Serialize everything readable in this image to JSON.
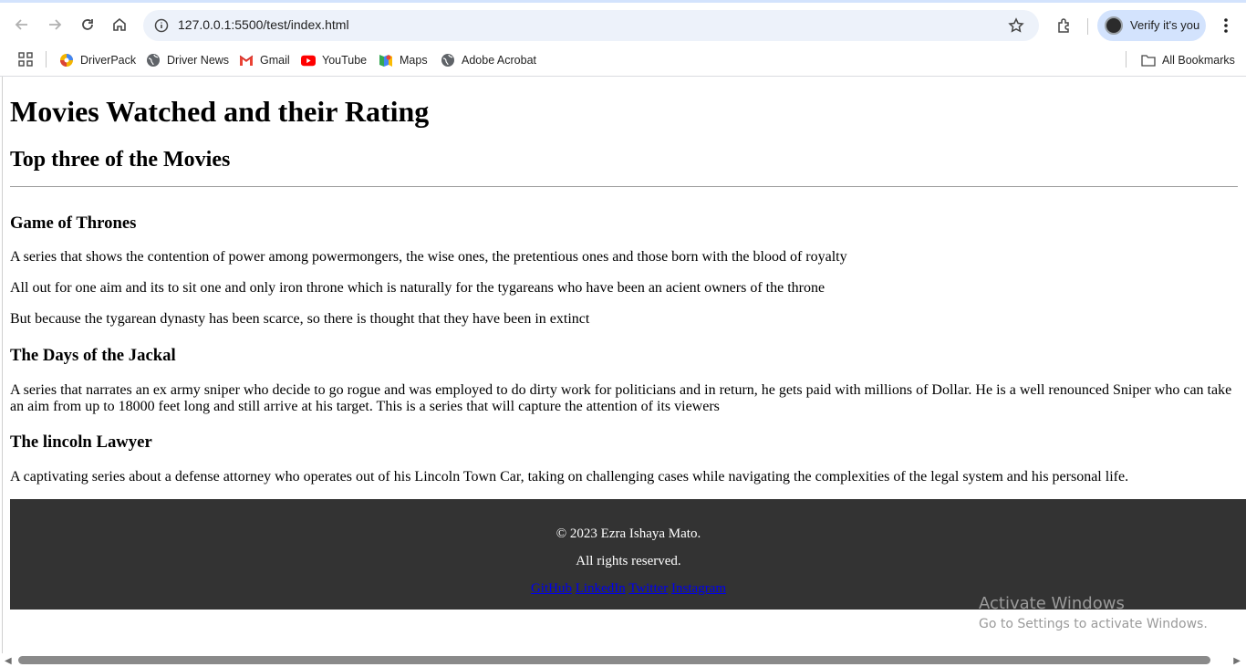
{
  "browser": {
    "url": "127.0.0.1:5500/test/index.html",
    "profile_label": "Verify it's you",
    "bookmarks": [
      {
        "label": "DriverPack",
        "icon": "driverpack-icon"
      },
      {
        "label": "Driver News",
        "icon": "globe-icon"
      },
      {
        "label": "Gmail",
        "icon": "gmail-icon"
      },
      {
        "label": "YouTube",
        "icon": "youtube-icon"
      },
      {
        "label": "Maps",
        "icon": "maps-icon"
      },
      {
        "label": "Adobe Acrobat",
        "icon": "globe-icon"
      }
    ],
    "all_bookmarks_label": "All Bookmarks",
    "accent_color": "#d3e3fd"
  },
  "page": {
    "title": "Movies Watched and their Rating",
    "subtitle": "Top three of the Movies",
    "movies": [
      {
        "title": "Game of Thrones",
        "paragraphs": [
          "A series that shows the contention of power among powermongers, the wise ones, the pretentious ones and those born with the blood of royalty",
          "All out for one aim and its to sit one and only iron throne which is naturally for the tygareans who have been an acient owners of the throne",
          "But because the tygarean dynasty has been scarce, so there is thought that they have been in extinct"
        ]
      },
      {
        "title": "The Days of the Jackal",
        "paragraphs": [
          "A series that narrates an ex army sniper who decide to go rogue and was employed to do dirty work for politicians and in return, he gets paid with millions of Dollar. He is a well renounced Sniper who can take an aim from up to 18000 feet long and still arrive at his target. This is a series that will capture the attention of its viewers"
        ]
      },
      {
        "title": "The lincoln Lawyer",
        "paragraphs": [
          "A captivating series about a defense attorney who operates out of his Lincoln Town Car, taking on challenging cases while navigating the complexities of the legal system and his personal life."
        ]
      }
    ],
    "footer": {
      "copyright": "© 2023 Ezra Ishaya Mato.",
      "rights": "All rights reserved.",
      "links": [
        "GitHub",
        "LinkedIn",
        "Twitter",
        "Instagram"
      ],
      "background": "#333333"
    }
  },
  "watermark": {
    "title": "Activate Windows",
    "subtitle": "Go to Settings to activate Windows."
  }
}
